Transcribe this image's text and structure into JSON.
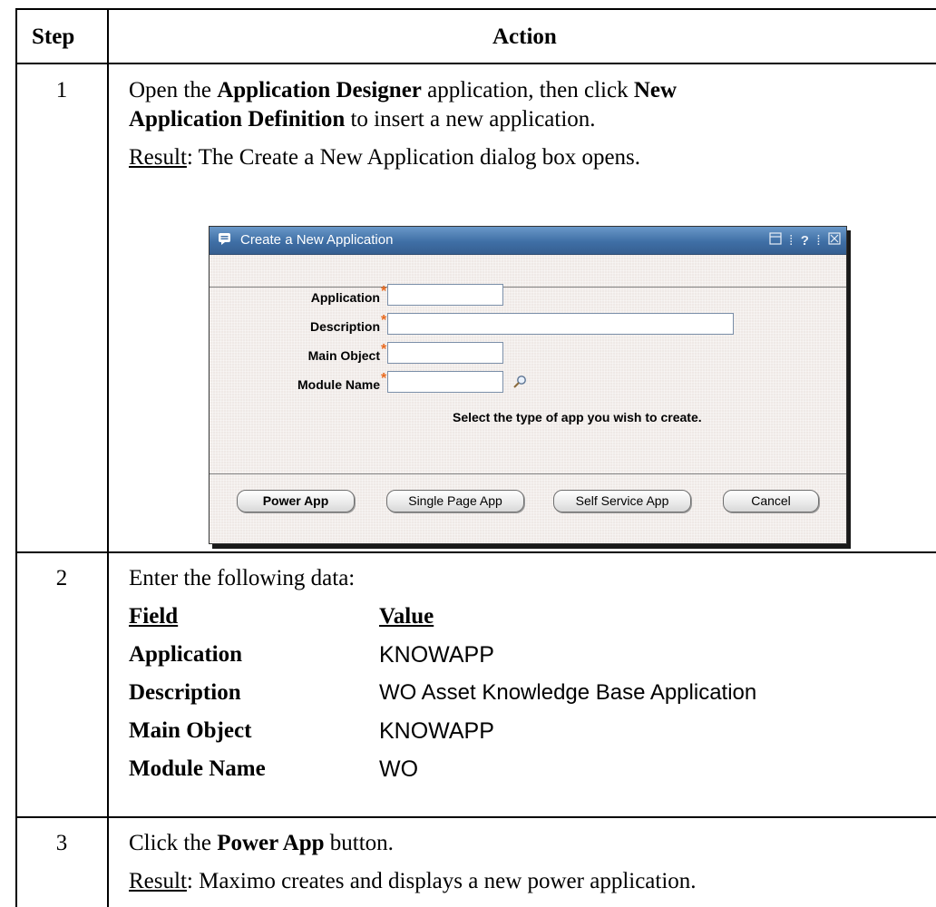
{
  "table": {
    "headers": {
      "step": "Step",
      "action": "Action"
    },
    "rows": [
      {
        "step": "1",
        "line1_pre": "Open the ",
        "line1_bold1": "Application Designer",
        "line1_mid": " application, then click ",
        "line1_bold2": "New",
        "line2_bold": "Application Definition",
        "line2_post": " to insert a new application.",
        "result_label": "Result",
        "result_text": ": The Create a New Application dialog box opens."
      },
      {
        "step": "2",
        "intro": "Enter the following data:",
        "field_header": "Field",
        "value_header": "Value",
        "entries": [
          {
            "field": "Application",
            "value": "KNOWAPP"
          },
          {
            "field": "Description",
            "value": "WO Asset Knowledge Base Application"
          },
          {
            "field": "Main Object",
            "value": "KNOWAPP"
          },
          {
            "field": "Module Name",
            "value": "WO"
          }
        ]
      },
      {
        "step": "3",
        "line1_pre": "Click the ",
        "line1_bold": "Power App",
        "line1_post": " button.",
        "result_label": "Result",
        "result_text": ": Maximo creates and displays a new power application."
      }
    ]
  },
  "dialog": {
    "title": "Create a New Application",
    "title_icon": "dialog-icon",
    "controls": [
      "minimize-icon",
      "help-icon",
      "close-icon"
    ],
    "help_glyph": "?",
    "fields": [
      {
        "label": "Application",
        "required_mark": "*",
        "value": ""
      },
      {
        "label": "Description",
        "required_mark": "*",
        "value": ""
      },
      {
        "label": "Main Object",
        "required_mark": "*",
        "value": ""
      },
      {
        "label": "Module Name",
        "required_mark": "*",
        "value": ""
      }
    ],
    "lookup_icon": "magnifier-icon",
    "hint": "Select the type of app you wish to create.",
    "buttons": {
      "power_app": "Power App",
      "single_page_app": "Single Page App",
      "self_service_app": "Self Service App",
      "cancel": "Cancel"
    },
    "colors": {
      "title_bar": "#3f6fa6",
      "required": "#e86a1f",
      "body": "#efe9e6"
    }
  }
}
